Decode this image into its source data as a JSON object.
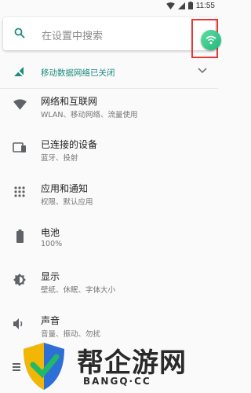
{
  "status_bar": {
    "time": "11:55",
    "icons": [
      "wifi-icon",
      "signal-icon",
      "battery-icon"
    ]
  },
  "search": {
    "placeholder": "在设置中搜索",
    "icon": "search-icon"
  },
  "suggestion": {
    "text": "移动数据网络已关闭",
    "icon": "mobile-data-off-icon",
    "color": "#1a8c7e"
  },
  "settings_items": [
    {
      "title": "网络和互联网",
      "subtitle": "WLAN、移动网络、流量使用",
      "icon": "wifi-icon"
    },
    {
      "title": "已连接的设备",
      "subtitle": "蓝牙、投射",
      "icon": "devices-icon"
    },
    {
      "title": "应用和通知",
      "subtitle": "权限、默认应用",
      "icon": "apps-grid-icon"
    },
    {
      "title": "电池",
      "subtitle": "100%",
      "icon": "battery-icon"
    },
    {
      "title": "显示",
      "subtitle": "壁纸、休眠、字体大小",
      "icon": "brightness-icon"
    },
    {
      "title": "声音",
      "subtitle": "音量、振动、勿扰",
      "icon": "volume-icon"
    }
  ],
  "watermark": {
    "text": "帮企游网",
    "sub": "BANGQ·CC"
  }
}
